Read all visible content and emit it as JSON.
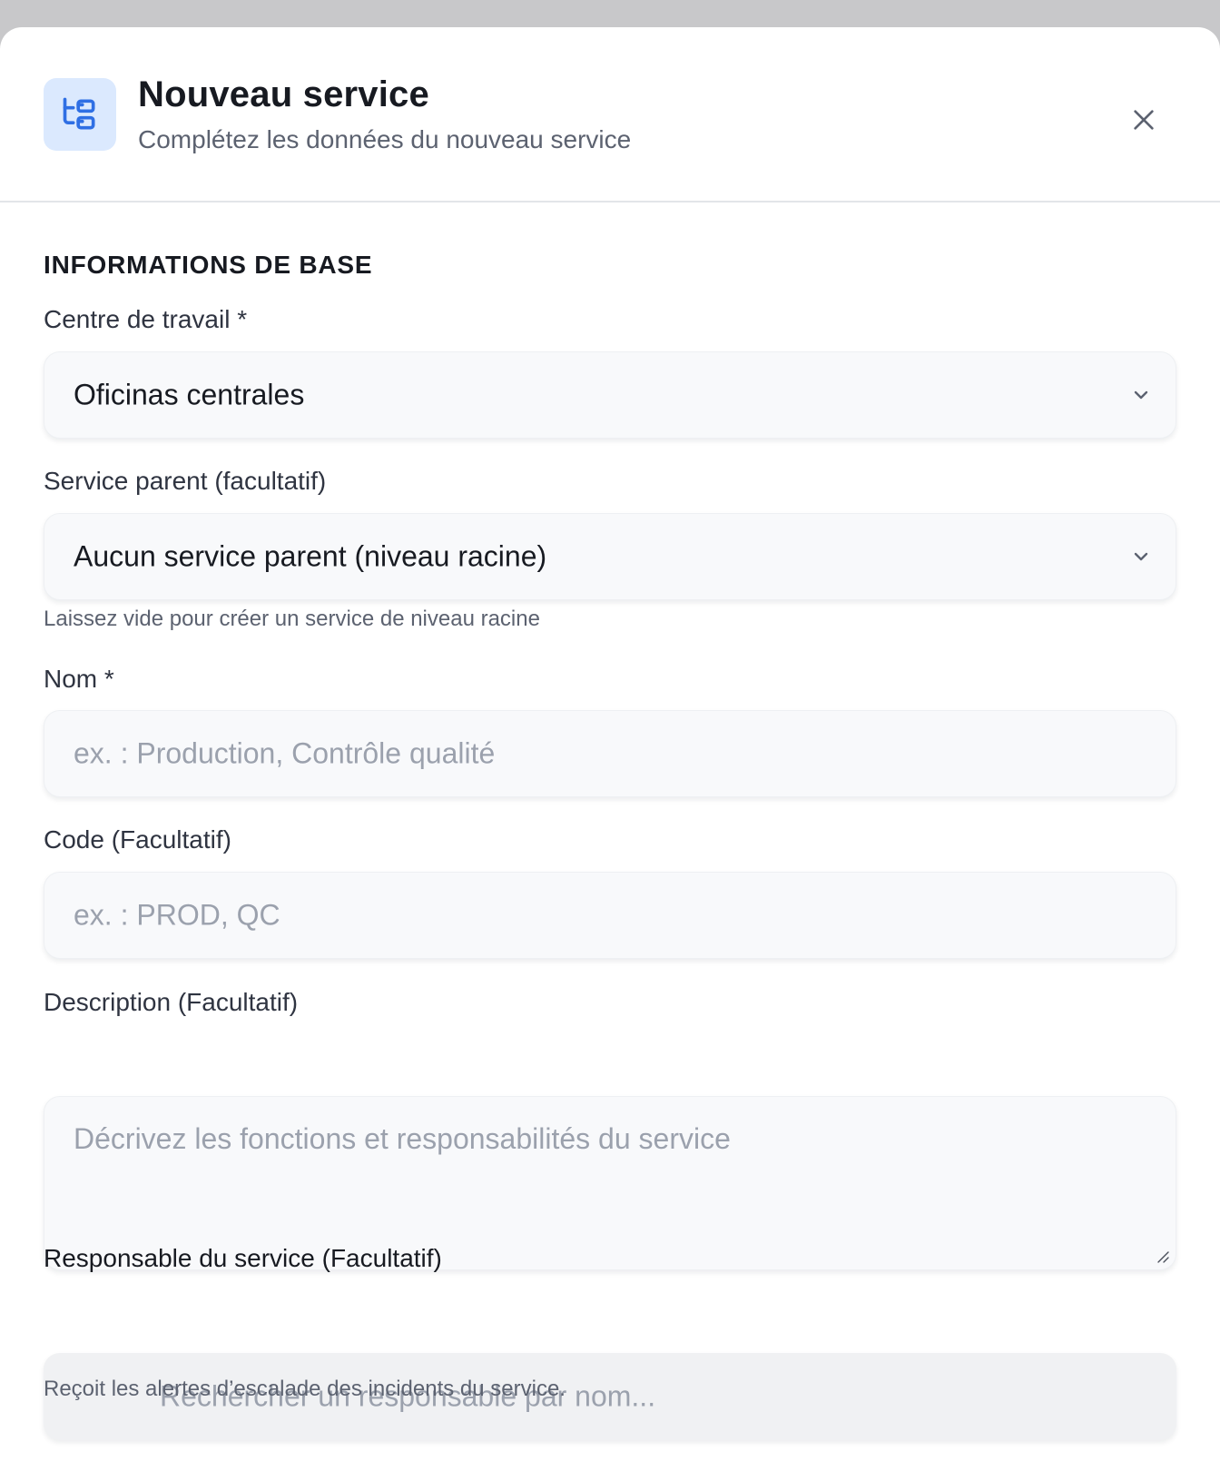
{
  "header": {
    "icon": "folder-tree-icon",
    "title": "Nouveau service",
    "subtitle": "Complétez les données du nouveau service",
    "close_icon": "close-icon"
  },
  "section": {
    "title": "INFORMATIONS DE BASE"
  },
  "fields": {
    "work_center": {
      "label": "Centre de travail *",
      "value": "Oficinas centrales"
    },
    "parent_service": {
      "label": "Service parent (facultatif)",
      "value": "Aucun service parent (niveau racine)",
      "help": "Laissez vide pour créer un service de niveau racine"
    },
    "name": {
      "label": "Nom *",
      "placeholder": "ex. : Production, Contrôle qualité"
    },
    "code": {
      "label": "Code (Facultatif)",
      "placeholder": "ex. : PROD, QC"
    },
    "description": {
      "label": "Description (Facultatif)",
      "placeholder": "Décrivez les fonctions et responsabilités du service"
    },
    "manager": {
      "label": "Responsable du service (Facultatif)",
      "placeholder": "Rechercher un responsable par nom...",
      "help": "Reçoit les alertes d’escalade des incidents du service."
    }
  },
  "colors": {
    "accent": "#2f6fe4",
    "icon_bg": "#dbe9fe"
  }
}
